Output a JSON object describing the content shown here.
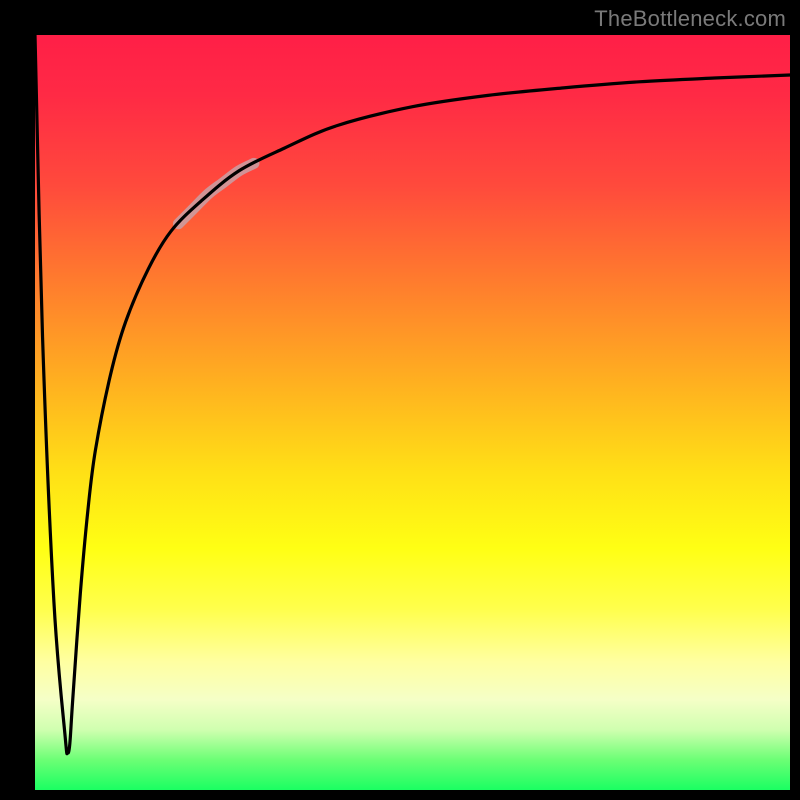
{
  "attribution": "TheBottleneck.com",
  "chart_data": {
    "type": "line",
    "title": "",
    "xlabel": "",
    "ylabel": "",
    "xlim": [
      0,
      100
    ],
    "ylim": [
      0,
      100
    ],
    "grid": false,
    "legend": false,
    "background_gradient": {
      "direction": "vertical",
      "stops": [
        {
          "pos": 0.0,
          "color": "#ff1f47"
        },
        {
          "pos": 0.33,
          "color": "#ff7d2d"
        },
        {
          "pos": 0.58,
          "color": "#ffe016"
        },
        {
          "pos": 0.76,
          "color": "#ffff4c"
        },
        {
          "pos": 0.92,
          "color": "#d0ffb0"
        },
        {
          "pos": 1.0,
          "color": "#1aff62"
        }
      ]
    },
    "series": [
      {
        "name": "curve",
        "color": "#000000",
        "x": [
          0,
          1,
          2.5,
          4,
          4.3,
          4.6,
          5,
          6,
          7,
          8,
          10,
          12,
          15,
          18,
          22,
          27,
          33,
          40,
          50,
          60,
          70,
          80,
          90,
          100
        ],
        "y": [
          100,
          60,
          25,
          7,
          5,
          6,
          12,
          26,
          37,
          45,
          55,
          62,
          69,
          74,
          78,
          82,
          85,
          88,
          90.5,
          92,
          93,
          93.8,
          94.3,
          94.7
        ]
      },
      {
        "name": "highlight-segment",
        "color": "#c9a0a6",
        "thickness": 11,
        "x": [
          19,
          21,
          23,
          25,
          27,
          29
        ],
        "y": [
          75,
          77,
          79,
          80.5,
          82,
          83
        ]
      }
    ]
  }
}
